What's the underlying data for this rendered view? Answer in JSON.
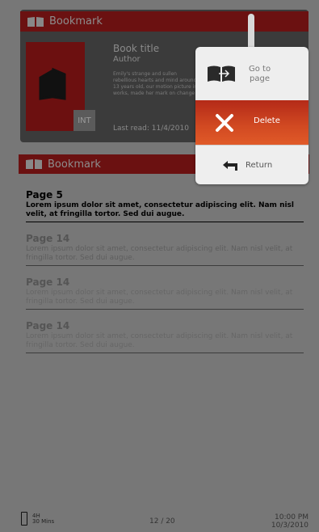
{
  "top_card": {
    "header_label": "Bookmark",
    "book_title": "Book title",
    "author": "Author",
    "description": "Emily's strange and sullen rebellious hearts and mind around. 13 years old, our motion picture in works, made her mark on change",
    "badge": "INT",
    "last_read": "Last read: 11/4/2010"
  },
  "bookmark_bar": {
    "label": "Bookmark"
  },
  "bookmarks": [
    {
      "page": "Page 5",
      "text": "Lorem ipsum dolor sit amet, consectetur adipiscing elit. Nam nisl velit, at fringilla tortor. Sed dui augue."
    },
    {
      "page": "Page 14",
      "text": "Lorem ipsum dolor sit amet, consectetur adipiscing elit. Nam nisl velit, at fringilla tortor. Sed dui augue."
    },
    {
      "page": "Page 14",
      "text": "Lorem ipsum dolor sit amet, consectetur adipiscing elit. Nam nisl velit, at fringilla tortor. Sed dui augue."
    },
    {
      "page": "Page 14",
      "text": "Lorem ipsum dolor sit amet, consectetur adipiscing elit. Nam nisl velit, at fringilla tortor. Sed dui augue."
    }
  ],
  "popup": {
    "goto_line1": "Go to",
    "goto_line2": "page",
    "delete": "Delete",
    "return": "Return"
  },
  "status": {
    "battery_percent": "4H",
    "battery_mins": "30 Mins",
    "page_counter": "12 / 20",
    "time": "10:00 PM",
    "date": "10/3/2010"
  },
  "colors": {
    "accent_red": "#6b1111",
    "delete_orange": "#d24a22",
    "background": "#777777"
  }
}
